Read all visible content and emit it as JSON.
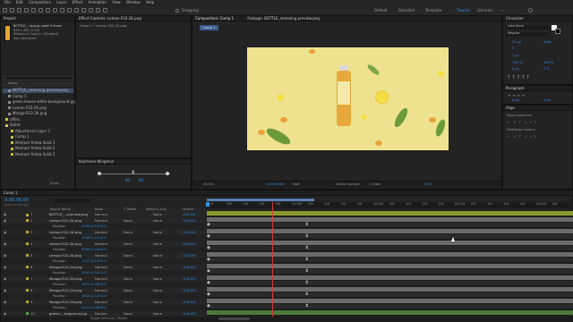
{
  "menu": [
    "File",
    "Edit",
    "Composition",
    "Layer",
    "Effect",
    "Animation",
    "View",
    "Window",
    "Help"
  ],
  "toolbar": {
    "snapping_label": "Snapping",
    "workspaces": [
      "Default",
      "Standard",
      "Template",
      "Tutorial",
      "Libraries"
    ],
    "active_workspace": "Tutorial"
  },
  "project": {
    "panel_title": "Project",
    "preview_name": "BOTTLE_...w.png",
    "preview_used": ", used 3 times",
    "preview_dims": "658 x 562 (1.00)",
    "preview_colors": "Millions of Colors+ (Straight)",
    "preview_interlace": "non-interlaced",
    "search_placeholder": "",
    "name_header": "Name",
    "items": [
      {
        "label": "BOTTLE_removing preview.png",
        "color": "#8a8a8a",
        "selected": true
      },
      {
        "label": "Comp 1",
        "color": "#8a8a8a",
        "selected": false
      },
      {
        "label": "green-leaves-white-background.jpg",
        "color": "#8a8a8a",
        "selected": false
      },
      {
        "label": "Lemon-F02-2K.png",
        "color": "#8a8a8a",
        "selected": false
      },
      {
        "label": "Mango-R12-2K.png",
        "color": "#8a8a8a",
        "selected": false
      },
      {
        "label": "offers",
        "color": "#d9c34a",
        "selected": false
      },
      {
        "label": "Solids",
        "color": "#d9c34a",
        "selected": false
      },
      {
        "label": "Adjustment Layer 1",
        "color": "#c9b84a",
        "selected": false
      },
      {
        "label": "Comp 1",
        "color": "#c9b84a",
        "selected": false
      },
      {
        "label": "Medium Yellow Solid 1",
        "color": "#c9b84a",
        "selected": false
      },
      {
        "label": "Medium Yellow Solid 2",
        "color": "#c9b84a",
        "selected": false
      },
      {
        "label": "Medium Yellow Solid 3",
        "color": "#c9b84a",
        "selected": false
      }
    ],
    "bpc": "8 bpc"
  },
  "effects": {
    "tab": "Effect Controls: Lemon-F02-2K.png",
    "subtitle": "Comp 1 • Lemon-F02-2K.png"
  },
  "composition": {
    "tab": "Composition: Comp 1",
    "footage_tab": "Footage: BOTTLE_removing preview.png",
    "comp_label": "Comp 1",
    "zoom": "33.3%",
    "resolution": "Half",
    "camera": "Active Camera",
    "views": "1 View",
    "exposure": "+0.0",
    "timecode": "0:00:00:00"
  },
  "keyframe_wingman": {
    "title": "Keyframe Wingman",
    "value_a": "80",
    "value_b": "80"
  },
  "character": {
    "title": "Character",
    "font": "Lato Semi",
    "style": "Regular",
    "size": "72 px",
    "leading": "Auto",
    "tracking": "0",
    "stroke": "1 px",
    "scale_v": "100 %",
    "scale_h": "100 %",
    "baseline": "0 px",
    "tsume": "0 %"
  },
  "paragraph": {
    "title": "Paragraph",
    "indent_a": "0 px",
    "indent_b": "0 px"
  },
  "align": {
    "title": "Align",
    "align_to": "Align Layers to:",
    "distribute": "Distribute Layers:"
  },
  "timeline": {
    "tab": "Comp 1",
    "timecode": "0:00:00:00",
    "fps_note": "00000 (25.00 fps)",
    "col_source": "Source Name",
    "col_mode": "Mode",
    "col_t": "T TrkMat",
    "col_parent": "Parent & Link",
    "col_stretch": "Stretch",
    "footer": "Toggle Switches / Modes",
    "ruler": [
      "0f",
      "05f",
      "10f",
      "15f",
      "20f",
      "01:00f",
      "05f",
      "10f",
      "15f",
      "20f",
      "02:00f",
      "05f",
      "10f",
      "15f",
      "20f",
      "03:00f",
      "05f",
      "10f",
      "15f",
      "20f",
      "04:00f",
      "05f"
    ],
    "layers": [
      {
        "num": "1",
        "name": "BOTTLE_...preview.png",
        "mode": "Normal",
        "track": "",
        "parent": "None",
        "stretch": "100.0%",
        "color": "#b8a640",
        "kind": "layer",
        "bar": "#8c9a2c"
      },
      {
        "num": "2",
        "name": "Lemon-F02-2K.png",
        "mode": "Normal",
        "track": "None",
        "parent": "None",
        "stretch": "100.0%",
        "color": "#b8a640",
        "kind": "layer",
        "bar": "#6b6b6b"
      },
      {
        "num": "",
        "name": "Position",
        "mode": "1094.0,1023.0",
        "track": "",
        "parent": "",
        "stretch": "",
        "color": "",
        "kind": "prop",
        "bar": "#2a2a2a"
      },
      {
        "num": "3",
        "name": "Lemon-F02-2K.png",
        "mode": "Normal",
        "track": "None",
        "parent": "None",
        "stretch": "100.0%",
        "color": "#b8a640",
        "kind": "layer",
        "bar": "#6b6b6b"
      },
      {
        "num": "",
        "name": "Position",
        "mode": "1016.0,1042.0",
        "track": "",
        "parent": "",
        "stretch": "",
        "color": "",
        "kind": "prop",
        "bar": "#2a2a2a"
      },
      {
        "num": "4",
        "name": "Lemon-F02-2K.png",
        "mode": "Normal",
        "track": "None",
        "parent": "None",
        "stretch": "100.0%",
        "color": "#b8a640",
        "kind": "layer",
        "bar": "#6b6b6b"
      },
      {
        "num": "",
        "name": "Position",
        "mode": "2094.0,2943.0",
        "track": "",
        "parent": "",
        "stretch": "",
        "color": "",
        "kind": "prop",
        "bar": "#2a2a2a"
      },
      {
        "num": "5",
        "name": "Lemon-F02-2K.png",
        "mode": "Normal",
        "track": "None",
        "parent": "None",
        "stretch": "100.0%",
        "color": "#b8a640",
        "kind": "layer",
        "bar": "#6b6b6b"
      },
      {
        "num": "",
        "name": "Position",
        "mode": "1717.0,1921.0",
        "track": "",
        "parent": "",
        "stretch": "",
        "color": "",
        "kind": "prop",
        "bar": "#2a2a2a"
      },
      {
        "num": "6",
        "name": "Mango-R12-2K.png",
        "mode": "Normal",
        "track": "None",
        "parent": "None",
        "stretch": "100.0%",
        "color": "#b8a640",
        "kind": "layer",
        "bar": "#6b6b6b"
      },
      {
        "num": "",
        "name": "Position",
        "mode": "1053.0,1812.0",
        "track": "",
        "parent": "",
        "stretch": "",
        "color": "",
        "kind": "prop",
        "bar": "#2a2a2a"
      },
      {
        "num": "7",
        "name": "Mango-R12-2K.png",
        "mode": "Normal",
        "track": "None",
        "parent": "None",
        "stretch": "100.0%",
        "color": "#b8a640",
        "kind": "layer",
        "bar": "#6b6b6b"
      },
      {
        "num": "",
        "name": "Position",
        "mode": "1972.0,2603.0",
        "track": "",
        "parent": "",
        "stretch": "",
        "color": "",
        "kind": "prop",
        "bar": "#2a2a2a"
      },
      {
        "num": "8",
        "name": "Mango-R12-2K.png",
        "mode": "Normal",
        "track": "None",
        "parent": "None",
        "stretch": "100.0%",
        "color": "#b8a640",
        "kind": "layer",
        "bar": "#6b6b6b"
      },
      {
        "num": "",
        "name": "Position",
        "mode": "1819.0,1203.0",
        "track": "",
        "parent": "",
        "stretch": "",
        "color": "",
        "kind": "prop",
        "bar": "#2a2a2a"
      },
      {
        "num": "9",
        "name": "Mango-R12-2K.png",
        "mode": "Normal",
        "track": "None",
        "parent": "None",
        "stretch": "100.0%",
        "color": "#b8a640",
        "kind": "layer",
        "bar": "#6b6b6b"
      },
      {
        "num": "",
        "name": "Position",
        "mode": "2413.0,2603.0",
        "track": "",
        "parent": "",
        "stretch": "",
        "color": "",
        "kind": "prop",
        "bar": "#2a2a2a"
      },
      {
        "num": "10",
        "name": "green-l...kdground.jpg",
        "mode": "Darken",
        "track": "None",
        "parent": "None",
        "stretch": "100.0%",
        "color": "#5aa05a",
        "kind": "layer",
        "bar": "#4a7a3a"
      }
    ]
  },
  "colors": {
    "accent": "#2f8fe6",
    "canvas_bg": "#efe28f",
    "playhead": "#d63a3a",
    "work_area": "#8c9a2c"
  }
}
